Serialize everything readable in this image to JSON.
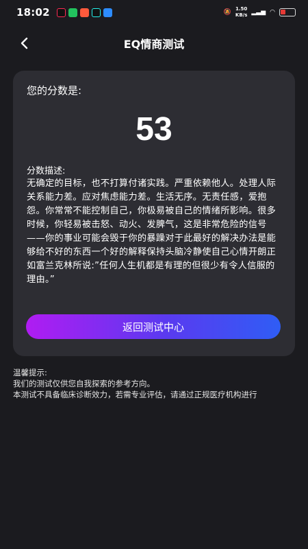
{
  "status_bar": {
    "time": "18:02",
    "net_speed": "1.50",
    "net_unit": "KB/s",
    "icons": [
      "tiktok-icon",
      "wechat-icon",
      "app-icon",
      "tiktok-icon",
      "app-icon"
    ]
  },
  "header": {
    "back_label": "‹",
    "title": "EQ情商测试"
  },
  "result": {
    "score_label": "您的分数是:",
    "score": "53",
    "description_label": "分数描述:",
    "description": "无确定的目标，也不打算付诸实践。严重依赖他人。处理人际关系能力差。应对焦虑能力差。生活无序。无责任感，爱抱怨。你常常不能控制自己，你极易被自己的情绪所影响。很多时候，你轻易被击怒、动火、发脾气，这是非常危险的信号——你的事业可能会毁于你的暴躁对于此最好的解决办法是能够给不好的东西一个好的解释保持头脑冷静使自己心情开朗正如富兰克林所说:”任何人生机都是有理的但很少有令人信服的理由。”",
    "button_label": "返回测试中心"
  },
  "tips": {
    "heading": "温馨提示:",
    "line1": "我们的测试仅供您自我探索的参考方向。",
    "line2": "本测试不具备临床诊断效力，若需专业评估，请通过正规医疗机构进行"
  },
  "colors": {
    "background": "#1b1b1f",
    "card": "#2d2d33",
    "button_gradient_start": "#b01cf2",
    "button_gradient_end": "#2f5df5"
  }
}
